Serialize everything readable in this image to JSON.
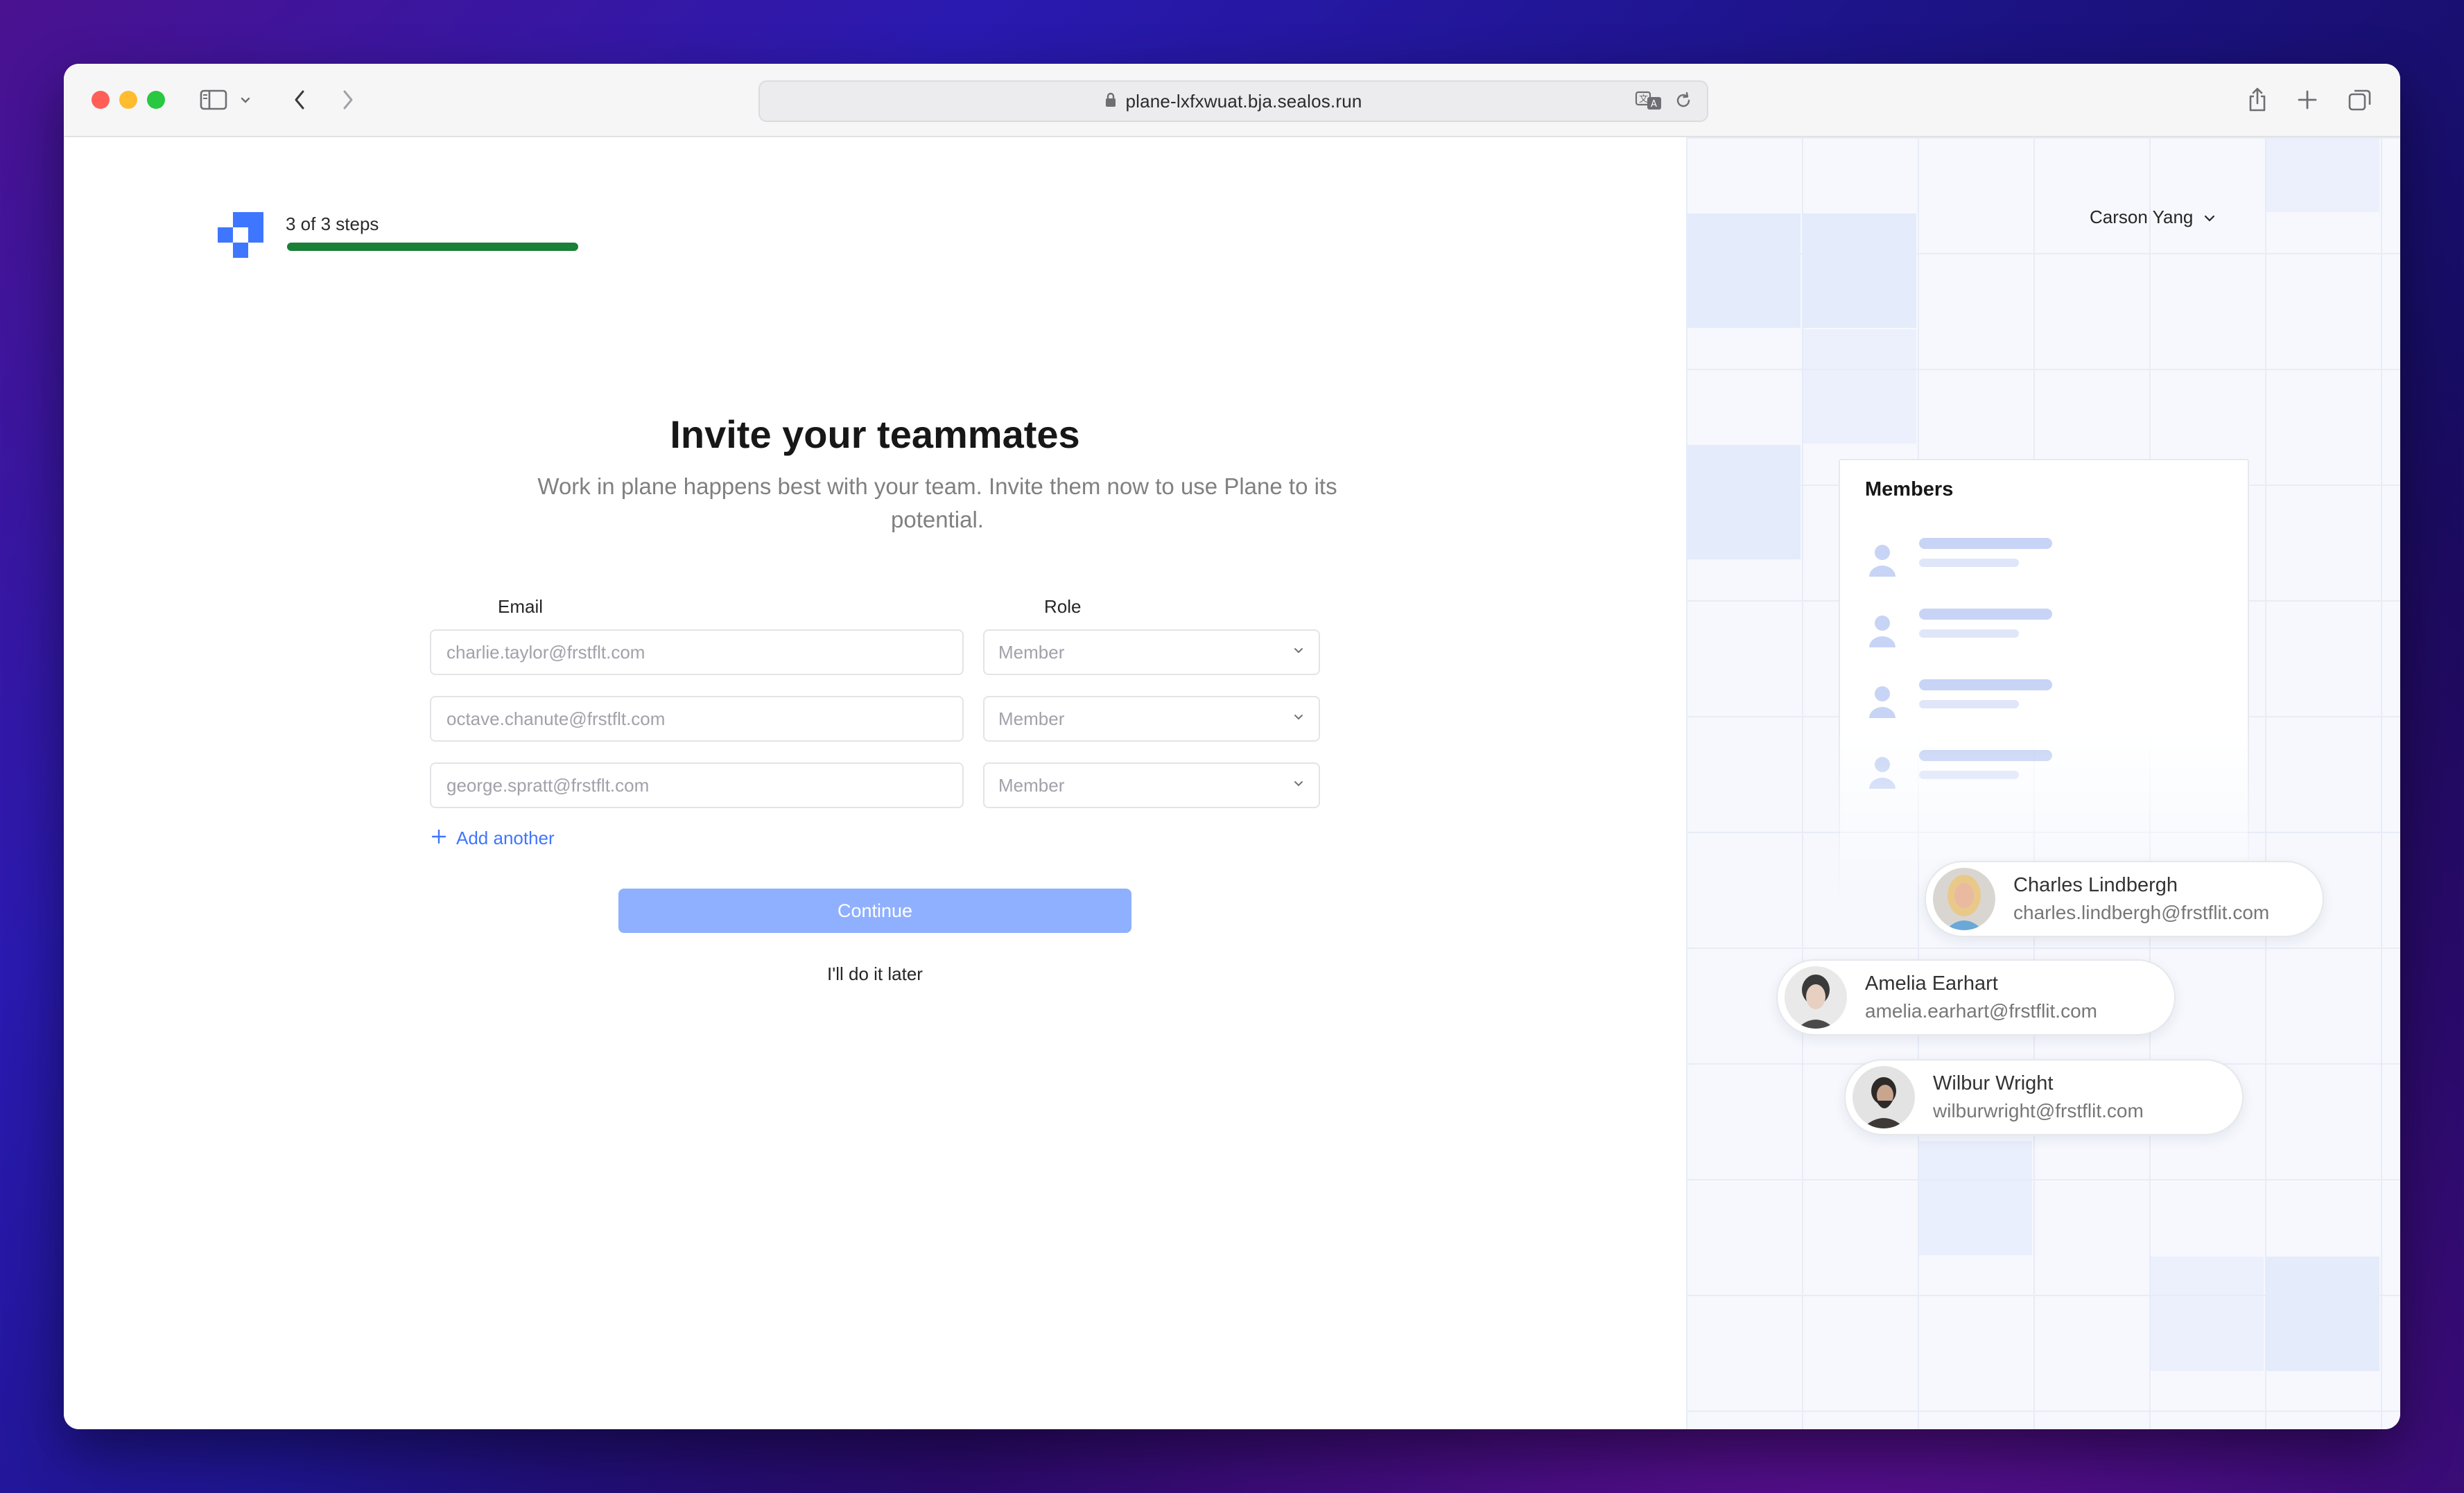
{
  "browser": {
    "url": "plane-lxfxwuat.bja.sealos.run"
  },
  "onboarding": {
    "steps_text": "3 of 3 steps",
    "progress_fraction": 1.0,
    "user_name": "Carson Yang",
    "heading": "Invite your teammates",
    "subtitle": "Work in plane happens best with your team. Invite them now to use Plane to its potential.",
    "email_label": "Email",
    "role_label": "Role",
    "invites": [
      {
        "email_placeholder": "charlie.taylor@frstflt.com",
        "role": "Member"
      },
      {
        "email_placeholder": "octave.chanute@frstflt.com",
        "role": "Member"
      },
      {
        "email_placeholder": "george.spratt@frstflt.com",
        "role": "Member"
      }
    ],
    "add_another": "Add another",
    "continue": "Continue",
    "later": "I'll do it later"
  },
  "illustration": {
    "members_title": "Members",
    "people": [
      {
        "name": "Charles Lindbergh",
        "email": "charles.lindbergh@frstflit.com"
      },
      {
        "name": "Amelia Earhart",
        "email": "amelia.earhart@frstflit.com"
      },
      {
        "name": "Wilbur Wright",
        "email": "wilburwright@frstflit.com"
      }
    ]
  },
  "colors": {
    "accent": "#3f76ff",
    "progress": "#1a7f37",
    "continue_disabled": "#8fb0ff"
  },
  "icons": [
    "sidebar-icon",
    "chevron-down-icon",
    "back-arrow-icon",
    "forward-arrow-icon",
    "lock-icon",
    "translate-icon",
    "reload-icon",
    "share-icon",
    "new-tab-icon",
    "tab-overview-icon",
    "plus-icon",
    "user-icon"
  ]
}
